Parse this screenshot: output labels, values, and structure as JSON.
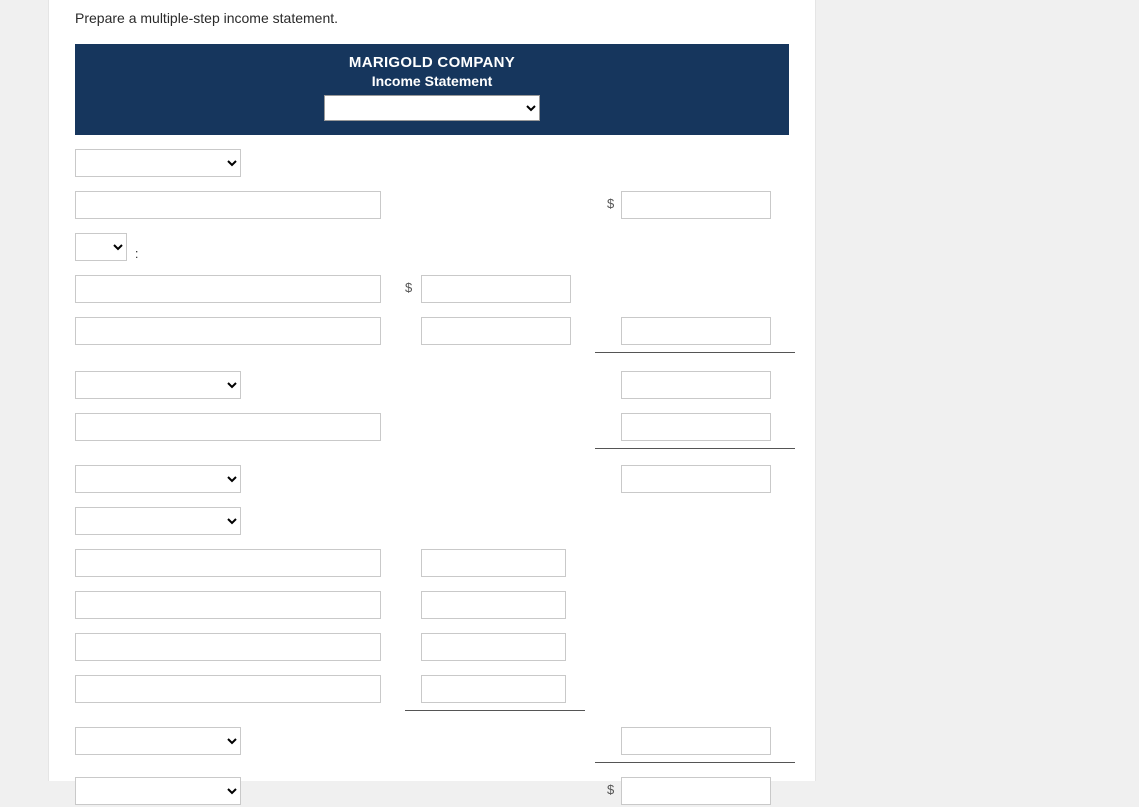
{
  "instruction": "Prepare a multiple-step income statement.",
  "header": {
    "company": "MARIGOLD COMPANY",
    "title": "Income Statement"
  },
  "symbols": {
    "dollar": "$",
    "colon": ":"
  },
  "rows": {
    "r1_select": "",
    "r2_label": "",
    "r2_amount": "",
    "r3_select": "",
    "r4_label": "",
    "r4_mid": "",
    "r5_label": "",
    "r5_mid": "",
    "r5_right": "",
    "r6_select": "",
    "r6_right": "",
    "r7_label": "",
    "r7_right": "",
    "r8_select": "",
    "r8_right": "",
    "r9_select": "",
    "r10_label": "",
    "r10_mid": "",
    "r11_label": "",
    "r11_mid": "",
    "r12_label": "",
    "r12_mid": "",
    "r13_label": "",
    "r13_mid": "",
    "r14_select": "",
    "r14_right": "",
    "r15_select": "",
    "r15_right": ""
  }
}
